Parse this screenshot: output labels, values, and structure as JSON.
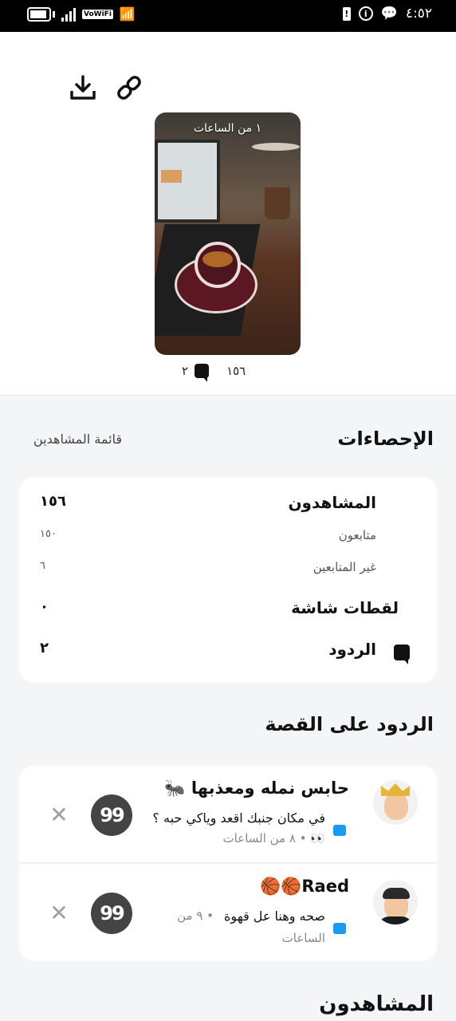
{
  "status_bar": {
    "network_label": "VoWiFi",
    "time": "٤:٥٢"
  },
  "story": {
    "caption": "١ من الساعات",
    "views_count": "١٥٦",
    "replies_count": "٢"
  },
  "stats": {
    "title": "الإحصاءات",
    "viewers_list_link": "قائمة المشاهدين",
    "rows": [
      {
        "label": "المشاهدون",
        "value": "١٥٦"
      },
      {
        "label": "متابعون",
        "value": "١٥٠"
      },
      {
        "label": "غير المتابعين",
        "value": "٦"
      },
      {
        "label": "لقطات شاشة",
        "value": "٠"
      },
      {
        "label": "الردود",
        "value": "٢"
      }
    ]
  },
  "replies": {
    "title": "الردود على القصة",
    "items": [
      {
        "name": "حابس نمله ومعذبها 🐜",
        "message": "في مكان جنبك اقعد وياكي حبه ؟",
        "meta": "👀 • ٨ من الساعات"
      },
      {
        "name": "Raed🏀🏀",
        "message": "صحه وهنا عل قهوة",
        "meta": "• ٩ من",
        "meta2": "الساعات"
      }
    ]
  },
  "viewers": {
    "title": "المشاهدون"
  },
  "colors": {
    "accent": "#1a9af0",
    "background": "#f3f5f7"
  },
  "icons": {
    "download": "download-icon",
    "link": "link-icon",
    "quote": "quote-reply-icon",
    "close": "close-icon"
  }
}
